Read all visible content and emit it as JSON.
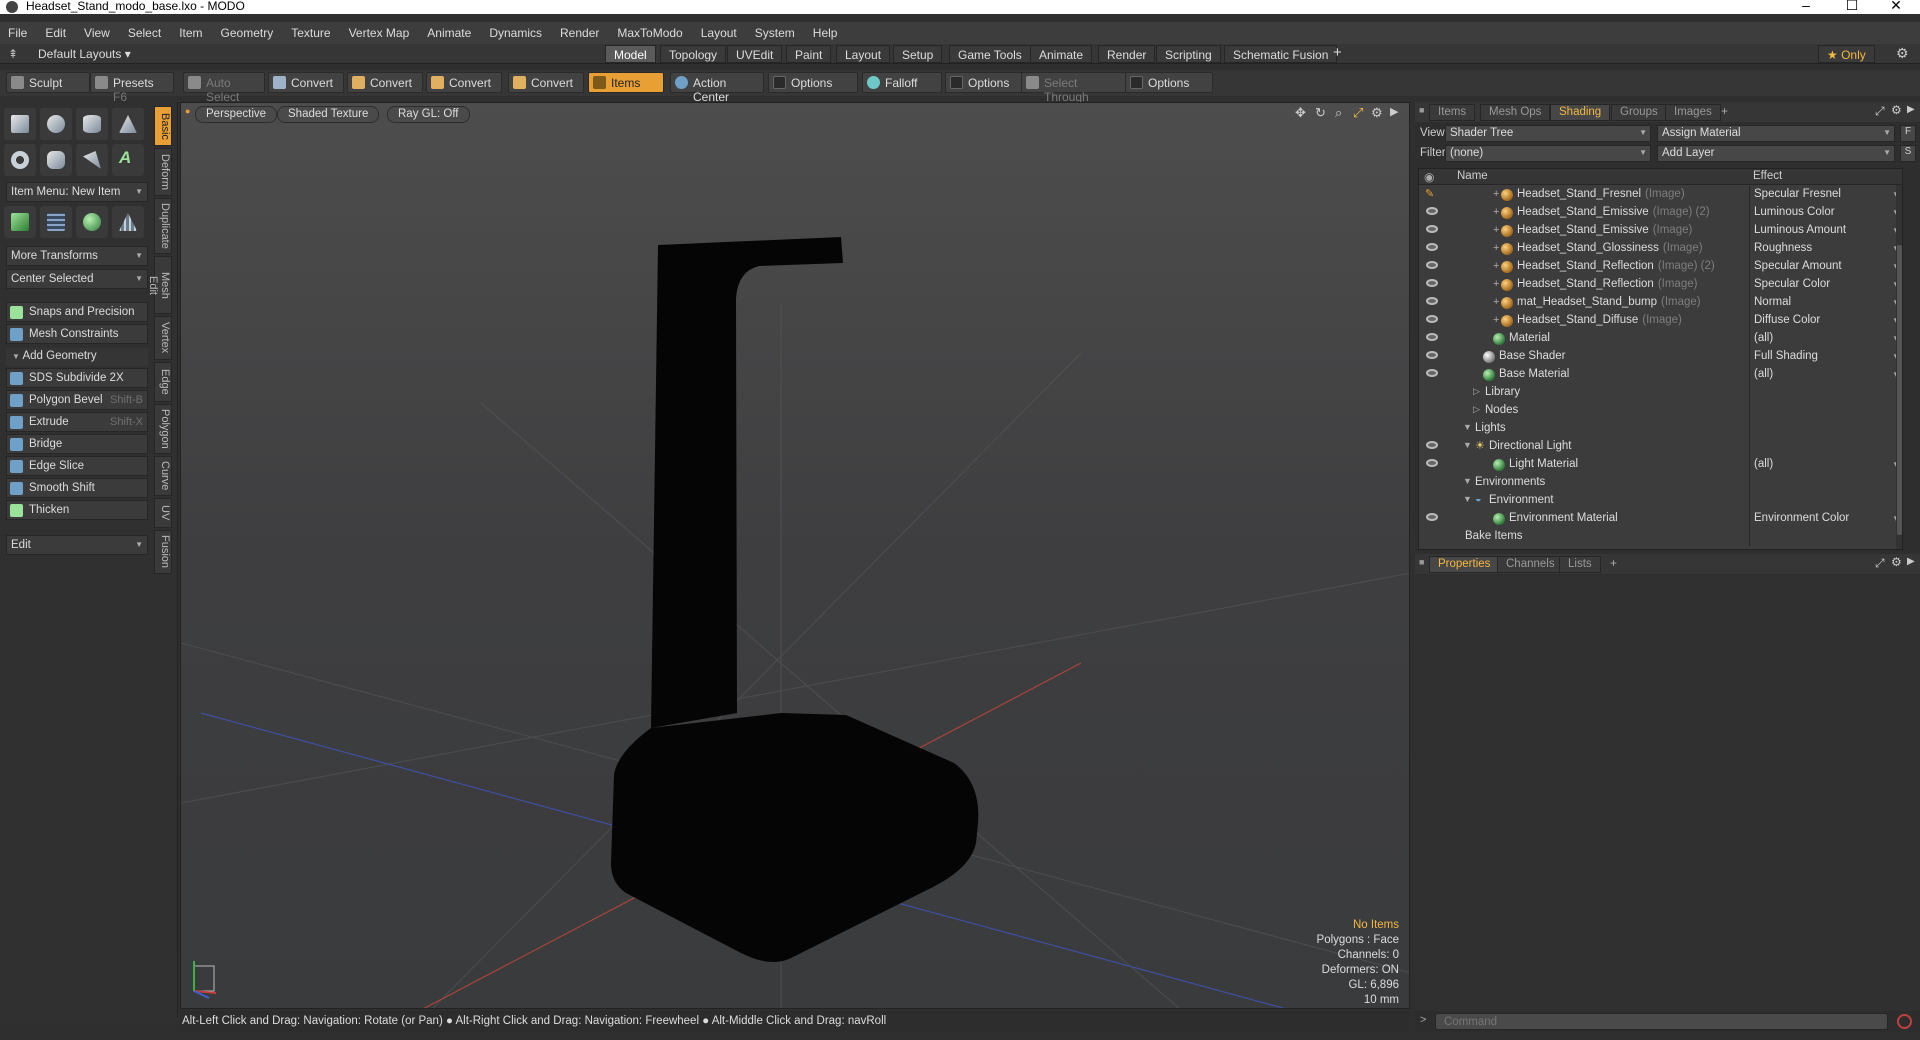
{
  "window": {
    "title": "Headset_Stand_modo_base.lxo - MODO",
    "minimize": "–",
    "maximize": "☐",
    "close": "✕"
  },
  "menu": [
    "File",
    "Edit",
    "View",
    "Select",
    "Item",
    "Geometry",
    "Texture",
    "Vertex Map",
    "Animate",
    "Dynamics",
    "Render",
    "MaxToModo",
    "Layout",
    "System",
    "Help"
  ],
  "layout": {
    "selector": "Default Layouts ▾",
    "tabs": [
      "Model",
      "Topology",
      "UVEdit",
      "Paint",
      "Layout",
      "Setup",
      "Game Tools",
      "Animate",
      "Render",
      "Scripting",
      "Schematic Fusion",
      "+"
    ],
    "active": "Model",
    "only": "★  Only"
  },
  "toolbar": {
    "sculpt": "Sculpt",
    "presets": "Presets",
    "presets_key": "F6",
    "auto_select": "Auto Select",
    "convert": "Convert",
    "items": "Items",
    "action_center": "Action Center",
    "options": "Options",
    "falloff": "Falloff",
    "select_through": "Select Through"
  },
  "left": {
    "item_menu": "Item Menu: New Item",
    "more_transforms": "More Transforms",
    "center_selected": "Center Selected",
    "snaps": "Snaps and Precision",
    "mesh_constraints": "Mesh Constraints",
    "add_geometry": "Add Geometry",
    "tools": [
      {
        "label": "SDS Subdivide 2X",
        "key": ""
      },
      {
        "label": "Polygon Bevel",
        "key": "Shift-B"
      },
      {
        "label": "Extrude",
        "key": "Shift-X"
      },
      {
        "label": "Bridge",
        "key": ""
      },
      {
        "label": "Edge Slice",
        "key": ""
      },
      {
        "label": "Smooth Shift",
        "key": ""
      },
      {
        "label": "Thicken",
        "key": ""
      }
    ],
    "edit": "Edit",
    "vtabs": [
      "Basic",
      "Deform",
      "Duplicate",
      "Mesh Edit",
      "Vertex",
      "Edge",
      "Polygon",
      "Curve",
      "UV",
      "Fusion"
    ]
  },
  "viewport": {
    "perspective": "Perspective",
    "shading": "Shaded Texture",
    "raygl": "Ray GL: Off",
    "info": {
      "items": "No Items",
      "polygons": "Polygons : Face",
      "channels": "Channels: 0",
      "deformers": "Deformers: ON",
      "gl": "GL: 6,896",
      "unit": "10 mm"
    }
  },
  "status": "Alt-Left Click and Drag: Navigation: Rotate (or Pan) ● Alt-Right Click and Drag: Navigation: Freewheel ● Alt-Middle Click and Drag: navRoll",
  "right": {
    "tabs": [
      "Items",
      "Mesh Ops",
      "Shading",
      "Groups",
      "Images",
      "+"
    ],
    "active": "Shading",
    "view_label": "View",
    "view_value": "Shader Tree",
    "assign": "Assign Material",
    "filter_label": "Filter",
    "filter_value": "(none)",
    "add_layer": "Add Layer",
    "col_name": "Name",
    "col_effect": "Effect",
    "f_btn": "F",
    "s_btn": "S",
    "rows": [
      {
        "name": "Headset_Stand_Fresnel",
        "suffix": "(Image)",
        "effect": "Specular Fresnel",
        "indent": 3,
        "type": "img",
        "plus": true,
        "dd": true,
        "eye": "brush"
      },
      {
        "name": "Headset_Stand_Emissive",
        "suffix": "(Image) (2)",
        "effect": "Luminous Color",
        "indent": 3,
        "type": "img",
        "plus": true,
        "dd": true,
        "eye": "eye"
      },
      {
        "name": "Headset_Stand_Emissive",
        "suffix": "(Image)",
        "effect": "Luminous Amount",
        "indent": 3,
        "type": "img",
        "plus": true,
        "dd": true,
        "eye": "eye"
      },
      {
        "name": "Headset_Stand_Glossiness",
        "suffix": "(Image)",
        "effect": "Roughness",
        "indent": 3,
        "type": "img",
        "plus": true,
        "dd": true,
        "eye": "eye"
      },
      {
        "name": "Headset_Stand_Reflection",
        "suffix": "(Image) (2)",
        "effect": "Specular Amount",
        "indent": 3,
        "type": "img",
        "plus": true,
        "dd": true,
        "eye": "eye"
      },
      {
        "name": "Headset_Stand_Reflection",
        "suffix": "(Image)",
        "effect": "Specular Color",
        "indent": 3,
        "type": "img",
        "plus": true,
        "dd": true,
        "eye": "eye"
      },
      {
        "name": "mat_Headset_Stand_bump",
        "suffix": "(Image)",
        "effect": "Normal",
        "indent": 3,
        "type": "img",
        "plus": true,
        "dd": true,
        "eye": "eye"
      },
      {
        "name": "Headset_Stand_Diffuse",
        "suffix": "(Image)",
        "effect": "Diffuse Color",
        "indent": 3,
        "type": "img",
        "plus": true,
        "dd": true,
        "eye": "eye"
      },
      {
        "name": "Material",
        "suffix": "",
        "effect": "(all)",
        "indent": 3,
        "type": "mat",
        "plus": false,
        "dd": true,
        "eye": "eye"
      },
      {
        "name": "Base Shader",
        "suffix": "",
        "effect": "Full Shading",
        "indent": 2,
        "type": "shader",
        "plus": false,
        "dd": true,
        "eye": "eye"
      },
      {
        "name": "Base Material",
        "suffix": "",
        "effect": "(all)",
        "indent": 2,
        "type": "mat",
        "plus": false,
        "dd": true,
        "eye": "eye"
      },
      {
        "name": "Library",
        "suffix": "",
        "effect": "",
        "indent": 2,
        "type": "tri",
        "plus": false,
        "dd": false,
        "eye": ""
      },
      {
        "name": "Nodes",
        "suffix": "",
        "effect": "",
        "indent": 2,
        "type": "tri",
        "plus": false,
        "dd": false,
        "eye": ""
      },
      {
        "name": "Lights",
        "suffix": "",
        "effect": "",
        "indent": 1,
        "type": "open",
        "plus": false,
        "dd": false,
        "eye": ""
      },
      {
        "name": "Directional Light",
        "suffix": "",
        "effect": "",
        "indent": 2,
        "type": "light",
        "plus": false,
        "dd": false,
        "eye": "eye"
      },
      {
        "name": "Light Material",
        "suffix": "",
        "effect": "(all)",
        "indent": 3,
        "type": "mat",
        "plus": false,
        "dd": true,
        "eye": "eye"
      },
      {
        "name": "Environments",
        "suffix": "",
        "effect": "",
        "indent": 1,
        "type": "open",
        "plus": false,
        "dd": false,
        "eye": ""
      },
      {
        "name": "Environment",
        "suffix": "",
        "effect": "",
        "indent": 2,
        "type": "env",
        "plus": false,
        "dd": false,
        "eye": ""
      },
      {
        "name": "Environment Material",
        "suffix": "",
        "effect": "Environment Color",
        "indent": 3,
        "type": "mat",
        "plus": false,
        "dd": true,
        "eye": "eye"
      },
      {
        "name": "Bake Items",
        "suffix": "",
        "effect": "",
        "indent": 1,
        "type": "none",
        "plus": false,
        "dd": false,
        "eye": ""
      }
    ],
    "props_tabs": [
      "Properties",
      "Channels",
      "Lists",
      "+"
    ],
    "props_active": "Properties",
    "command_placeholder": "Command"
  }
}
